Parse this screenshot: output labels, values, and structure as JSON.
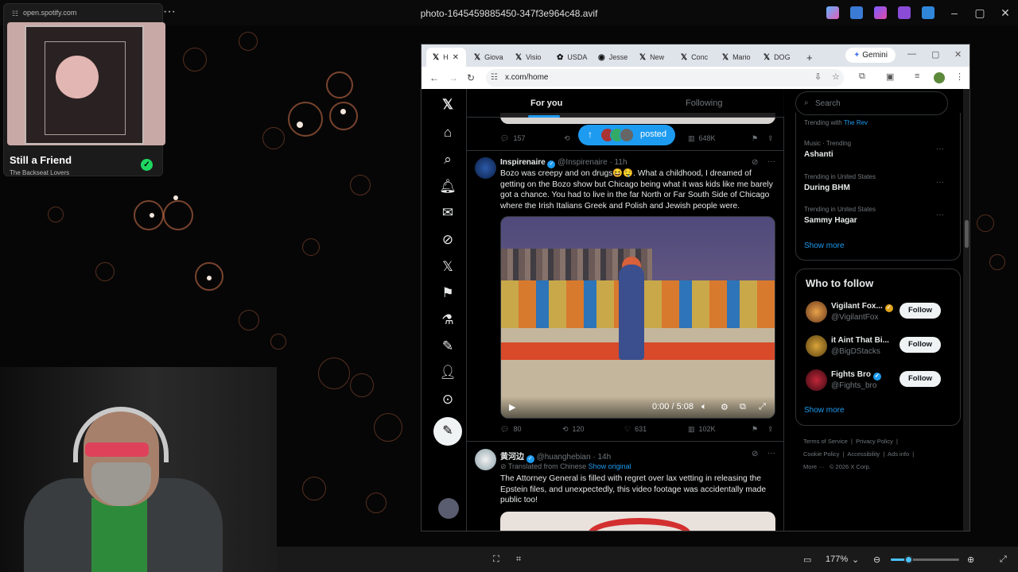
{
  "viewer": {
    "title": "photo-1645459885450-347f3e964c48.avif",
    "zoom": "177%",
    "zoom_fraction": 0.25
  },
  "spotify": {
    "url": "open.spotify.com",
    "track": "Still a Friend",
    "artist": "The Backseat Lovers"
  },
  "browser": {
    "tabs": [
      {
        "icon": "x-icon",
        "label": "H",
        "active": true
      },
      {
        "icon": "x-icon",
        "label": "Giova"
      },
      {
        "icon": "x-icon",
        "label": "Visio"
      },
      {
        "icon": "usda-icon",
        "label": "USDA"
      },
      {
        "icon": "jesse-icon",
        "label": "Jesse"
      },
      {
        "icon": "x-icon",
        "label": "New"
      },
      {
        "icon": "x-icon",
        "label": "Conc"
      },
      {
        "icon": "x-icon",
        "label": "Mario"
      },
      {
        "icon": "x-icon",
        "label": "DOG"
      }
    ],
    "gemini_label": "Gemini",
    "url": "x.com/home"
  },
  "x": {
    "tabs": {
      "for_you": "For you",
      "following": "Following"
    },
    "posted_pill": "posted",
    "prev_tweet_actions": {
      "replies": "157",
      "views": "648K"
    },
    "tweet1": {
      "name": "Inspirenaire",
      "handle": "@Inspirenaire",
      "time": "· 11h",
      "text": "Bozo was creepy and on drugs😆🤤.  What a childhood, I dreamed of getting on the Bozo show but Chicago being what it was kids like me barely got a chance.  You had to live in the far North or Far South Side of Chicago where the Irish Italians Greek and Polish and Jewish people were.",
      "video_time": "0:00 / 5:08",
      "replies": "80",
      "reposts": "120",
      "likes": "631",
      "views": "102K"
    },
    "tweet2": {
      "name": "黄河边",
      "handle": "@huanghebian",
      "time": "· 14h",
      "translated": "Translated from Chinese",
      "show_original": "Show original",
      "text": "The Attorney General is filled with regret over lax vetting in releasing the Epstein files, and unexpectedly, this video footage was accidentally made public too!"
    },
    "search_placeholder": "Search",
    "trends": [
      {
        "context": "Trending with",
        "link": "The Rev",
        "name": ""
      },
      {
        "context": "Music · Trending",
        "name": "Ashanti"
      },
      {
        "context": "Trending in United States",
        "name": "During BHM"
      },
      {
        "context": "Trending in United States",
        "name": "Sammy Hagar"
      }
    ],
    "show_more": "Show more",
    "who_to_follow": {
      "title": "Who to follow",
      "follow_label": "Follow",
      "accounts": [
        {
          "name": "Vigilant Fox...",
          "handle": "@VigilantFox"
        },
        {
          "name": "it Aint That Bi...",
          "handle": "@BigDStacks"
        },
        {
          "name": "Fights Bro",
          "handle": "@Fights_bro"
        }
      ]
    },
    "footer": {
      "terms": "Terms of Service",
      "privacy": "Privacy Policy",
      "cookie": "Cookie Policy",
      "accessibility": "Accessibility",
      "ads": "Ads info",
      "more": "More ···",
      "copyright": "© 2026 X Corp."
    }
  }
}
